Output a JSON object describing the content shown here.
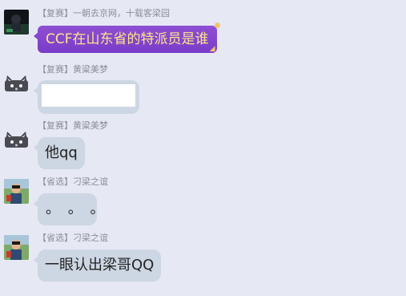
{
  "messages": [
    {
      "sender": "【复赛】一朝去京网，十载客梁园",
      "text": "CCF在山东省的特派员是谁",
      "style": "purple",
      "avatar": "dark-portrait-avatar"
    },
    {
      "sender": "【复赛】黄粱美梦",
      "text": "",
      "style": "image",
      "avatar": "cat-avatar"
    },
    {
      "sender": "【复赛】黄粱美梦",
      "text": "他qq",
      "style": "normal",
      "avatar": "cat-avatar"
    },
    {
      "sender": "【省选】刁梁之谊",
      "text": "。 。 。",
      "style": "normal",
      "avatar": "person-avatar"
    },
    {
      "sender": "【省选】刁梁之谊",
      "text": "一眼认出梁哥QQ",
      "style": "normal",
      "avatar": "person-avatar"
    }
  ],
  "colors": {
    "background": "#e6e9f4",
    "bubble": "#cdd6e3",
    "purple_bubble": "#7a3cc8",
    "purple_text": "#ffe38a"
  }
}
